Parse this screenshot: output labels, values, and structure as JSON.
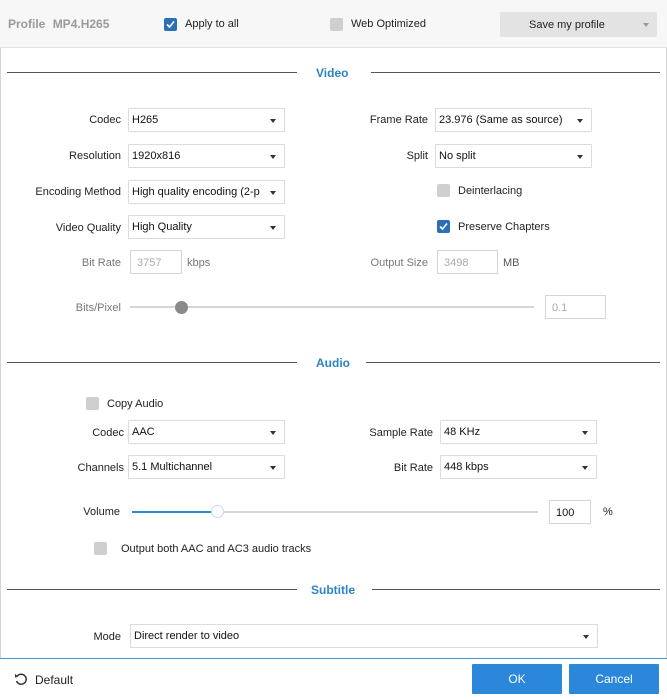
{
  "header": {
    "profile_label": "Profile",
    "profile_name": "MP4.H265",
    "apply_to_all": {
      "label": "Apply to all",
      "checked": true
    },
    "web_optimized": {
      "label": "Web Optimized",
      "checked": false
    },
    "save_profile_label": "Save my profile"
  },
  "video": {
    "section_title": "Video",
    "codec": {
      "label": "Codec",
      "value": "H265"
    },
    "resolution": {
      "label": "Resolution",
      "value": "1920x816"
    },
    "encoding_method": {
      "label": "Encoding Method",
      "value": "High quality encoding (2-p"
    },
    "video_quality": {
      "label": "Video Quality",
      "value": "High Quality"
    },
    "bit_rate": {
      "label": "Bit Rate",
      "value": "3757",
      "unit": "kbps"
    },
    "frame_rate": {
      "label": "Frame Rate",
      "value": "23.976 (Same as source)"
    },
    "split": {
      "label": "Split",
      "value": "No split"
    },
    "deinterlacing": {
      "label": "Deinterlacing",
      "checked": false
    },
    "preserve_chapters": {
      "label": "Preserve Chapters",
      "checked": true
    },
    "output_size": {
      "label": "Output Size",
      "value": "3498",
      "unit": "MB"
    },
    "bits_pixel": {
      "label": "Bits/Pixel",
      "value": "0.1",
      "slider_fraction": 0.125
    }
  },
  "audio": {
    "section_title": "Audio",
    "copy_audio": {
      "label": "Copy Audio",
      "checked": false
    },
    "codec": {
      "label": "Codec",
      "value": "AAC"
    },
    "channels": {
      "label": "Channels",
      "value": "5.1 Multichannel"
    },
    "sample_rate": {
      "label": "Sample Rate",
      "value": "48 KHz"
    },
    "bit_rate": {
      "label": "Bit Rate",
      "value": "448 kbps"
    },
    "volume": {
      "label": "Volume",
      "value": "100",
      "unit": "%",
      "slider_fraction": 0.21
    },
    "output_both": {
      "label": "Output both AAC and AC3 audio tracks",
      "checked": false
    }
  },
  "subtitle": {
    "section_title": "Subtitle",
    "mode": {
      "label": "Mode",
      "value": "Direct render to video"
    }
  },
  "footer": {
    "default_label": "Default",
    "ok_label": "OK",
    "cancel_label": "Cancel"
  },
  "colors": {
    "accent": "#2b87d9",
    "section_title": "#2b84c6",
    "checkbox_on": "#2a6fb8",
    "checkbox_off": "#cfcfcf"
  },
  "icons": [
    "checkmark-icon",
    "chevron-down-icon",
    "reset-icon"
  ]
}
